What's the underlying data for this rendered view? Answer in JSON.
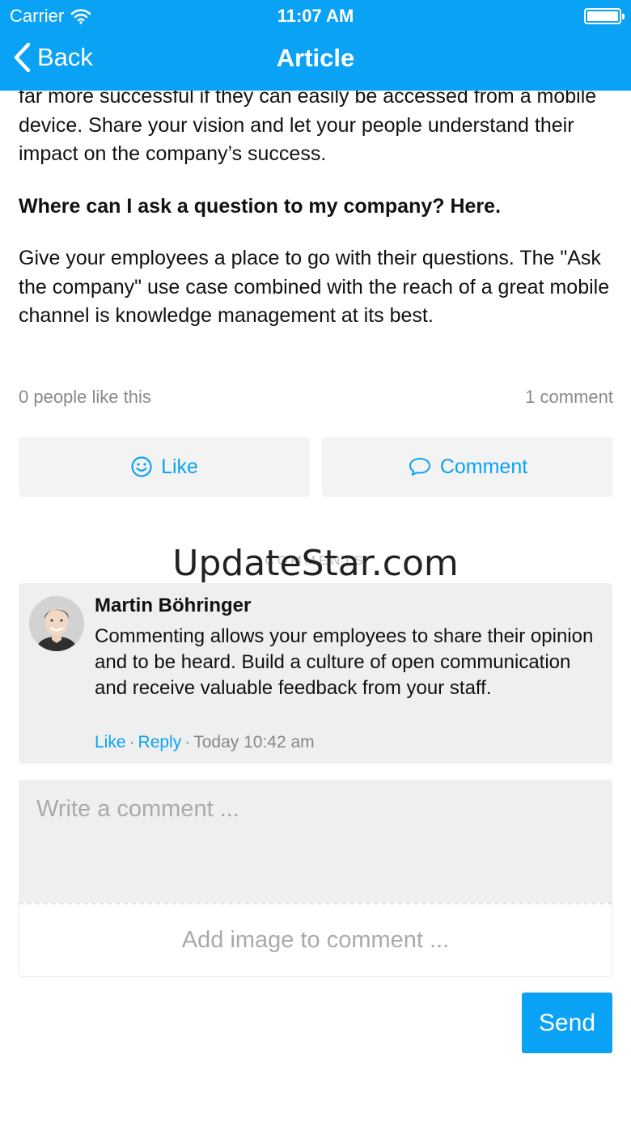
{
  "status_bar": {
    "carrier": "Carrier",
    "time": "11:07 AM",
    "icons": [
      "wifi-icon",
      "battery-icon"
    ]
  },
  "nav": {
    "back_label": "Back",
    "title": "Article",
    "back_icon": "chevron-left-icon"
  },
  "article": {
    "paragraph_top": "far more successful if they can easily be accessed from a mobile device. Share your vision and let your people understand their impact on the company’s success.",
    "heading": "Where can I ask a question to my company? Here.",
    "paragraph_body": "Give your employees a place to go with their questions. The \"Ask the company\" use case combined with the reach of a great mobile channel is knowledge management at its best."
  },
  "stats": {
    "likes": "0 people like this",
    "comments": "1 comment"
  },
  "actions": {
    "like_label": "Like",
    "like_icon": "smiley-icon",
    "comment_label": "Comment",
    "comment_icon": "speech-bubble-icon"
  },
  "comments_section": {
    "title": "COMMENTS",
    "watermark": "UpdateStar.com",
    "items": [
      {
        "author": "Martin Böhringer",
        "text": "Commenting allows your employees to share their opinion and to be heard. Build a culture of open communication and receive valuable feedback from your staff.",
        "like_label": "Like",
        "reply_label": "Reply",
        "timestamp": "Today 10:42 am"
      }
    ]
  },
  "composer": {
    "placeholder": "Write a comment ...",
    "add_image_label": "Add image to comment ...",
    "send_label": "Send"
  },
  "colors": {
    "accent": "#0aa2f5",
    "card_background": "#efefef",
    "muted_text": "#8a8a8a"
  }
}
